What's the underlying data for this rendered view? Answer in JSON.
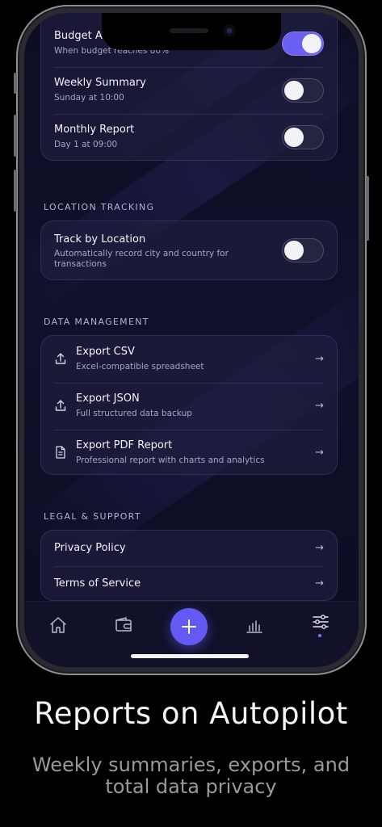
{
  "notifications": {
    "items": [
      {
        "title": "Budget Alerts",
        "subtitle": "When budget reaches 80%",
        "on": true
      },
      {
        "title": "Weekly Summary",
        "subtitle": "Sunday at 10:00",
        "on": false
      },
      {
        "title": "Monthly Report",
        "subtitle": "Day 1 at 09:00",
        "on": false
      }
    ]
  },
  "location": {
    "section": "LOCATION TRACKING",
    "title": "Track by Location",
    "subtitle_line1": "Automatically record city and country for",
    "subtitle_line2": "transactions",
    "on": false
  },
  "data_management": {
    "section": "DATA MANAGEMENT",
    "items": [
      {
        "title": "Export CSV",
        "subtitle": "Excel-compatible spreadsheet",
        "icon": "export-icon"
      },
      {
        "title": "Export JSON",
        "subtitle": "Full structured data backup",
        "icon": "export-icon"
      },
      {
        "title": "Export PDF Report",
        "subtitle": "Professional report with charts and analytics",
        "icon": "document-icon"
      }
    ]
  },
  "legal": {
    "section": "LEGAL & SUPPORT",
    "items": [
      {
        "title": "Privacy Policy"
      },
      {
        "title": "Terms of Service"
      }
    ]
  },
  "arrow": "→",
  "tabbar": {
    "tabs": [
      "home-icon",
      "wallet-icon",
      "add-icon",
      "chart-icon",
      "settings-icon"
    ],
    "active": "settings-icon"
  },
  "colors": {
    "accent": "#6459f2",
    "background": "#0d0d24"
  },
  "promo": {
    "headline": "Reports on Autopilot",
    "subline1": "Weekly summaries, exports, and",
    "subline2": "total data privacy"
  }
}
